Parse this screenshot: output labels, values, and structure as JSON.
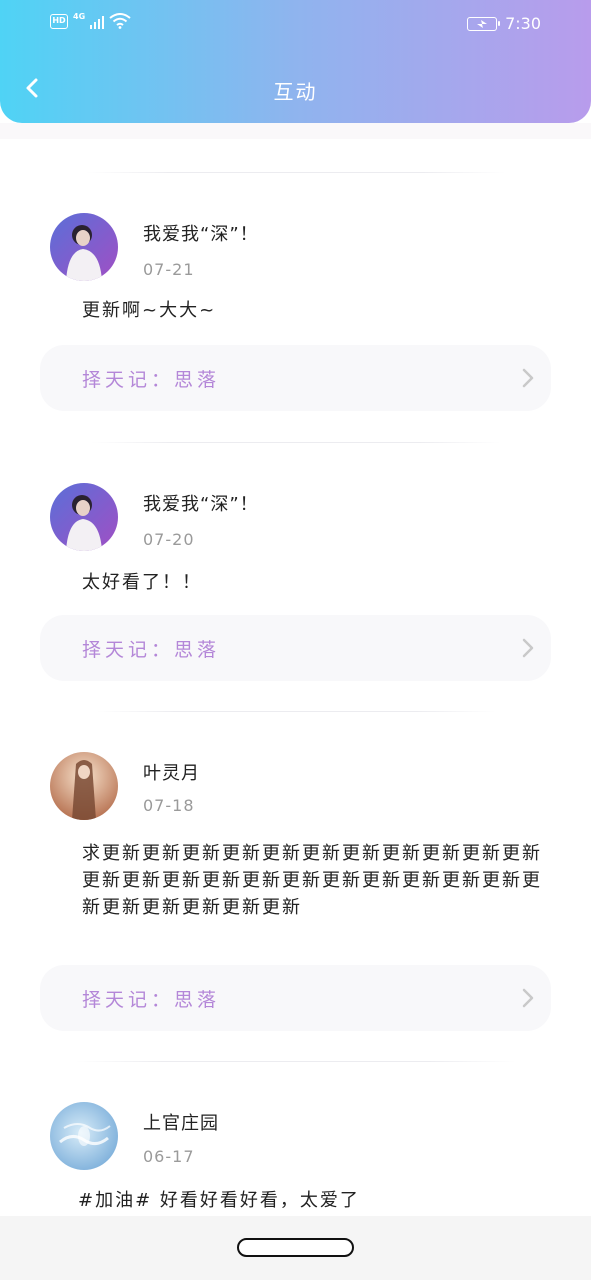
{
  "status_bar": {
    "hd": "HD",
    "network": "4G",
    "time": "7:30",
    "icons": [
      "signal-icon",
      "wifi-icon",
      "battery-charging-icon"
    ]
  },
  "header": {
    "title": "互动",
    "back_icon": "chevron-left-icon",
    "gradient": [
      "#4fd3f5",
      "#b89cec"
    ]
  },
  "accent_color": "#b487d8",
  "posts": [
    {
      "username": "我爱我“深”！",
      "date": "07-21",
      "content": "更新啊~大大~",
      "source": "择天记：思落",
      "avatar": "avatar-performer"
    },
    {
      "username": "我爱我“深”！",
      "date": "07-20",
      "content": "太好看了！！",
      "source": "择天记：思落",
      "avatar": "avatar-performer"
    },
    {
      "username": "叶灵月",
      "date": "07-18",
      "content": "求更新更新更新更新更新更新更新更新更新更新更新更新更新更新更新更新更新更新更新更新更新更新更新更新更新更新更新更新",
      "source": "择天记：思落",
      "avatar": "avatar-illustration"
    },
    {
      "username": "上官庄园",
      "date": "06-17",
      "content": "#加油# 好看好看好看，太爱了",
      "source": "",
      "avatar": "avatar-water"
    }
  ]
}
